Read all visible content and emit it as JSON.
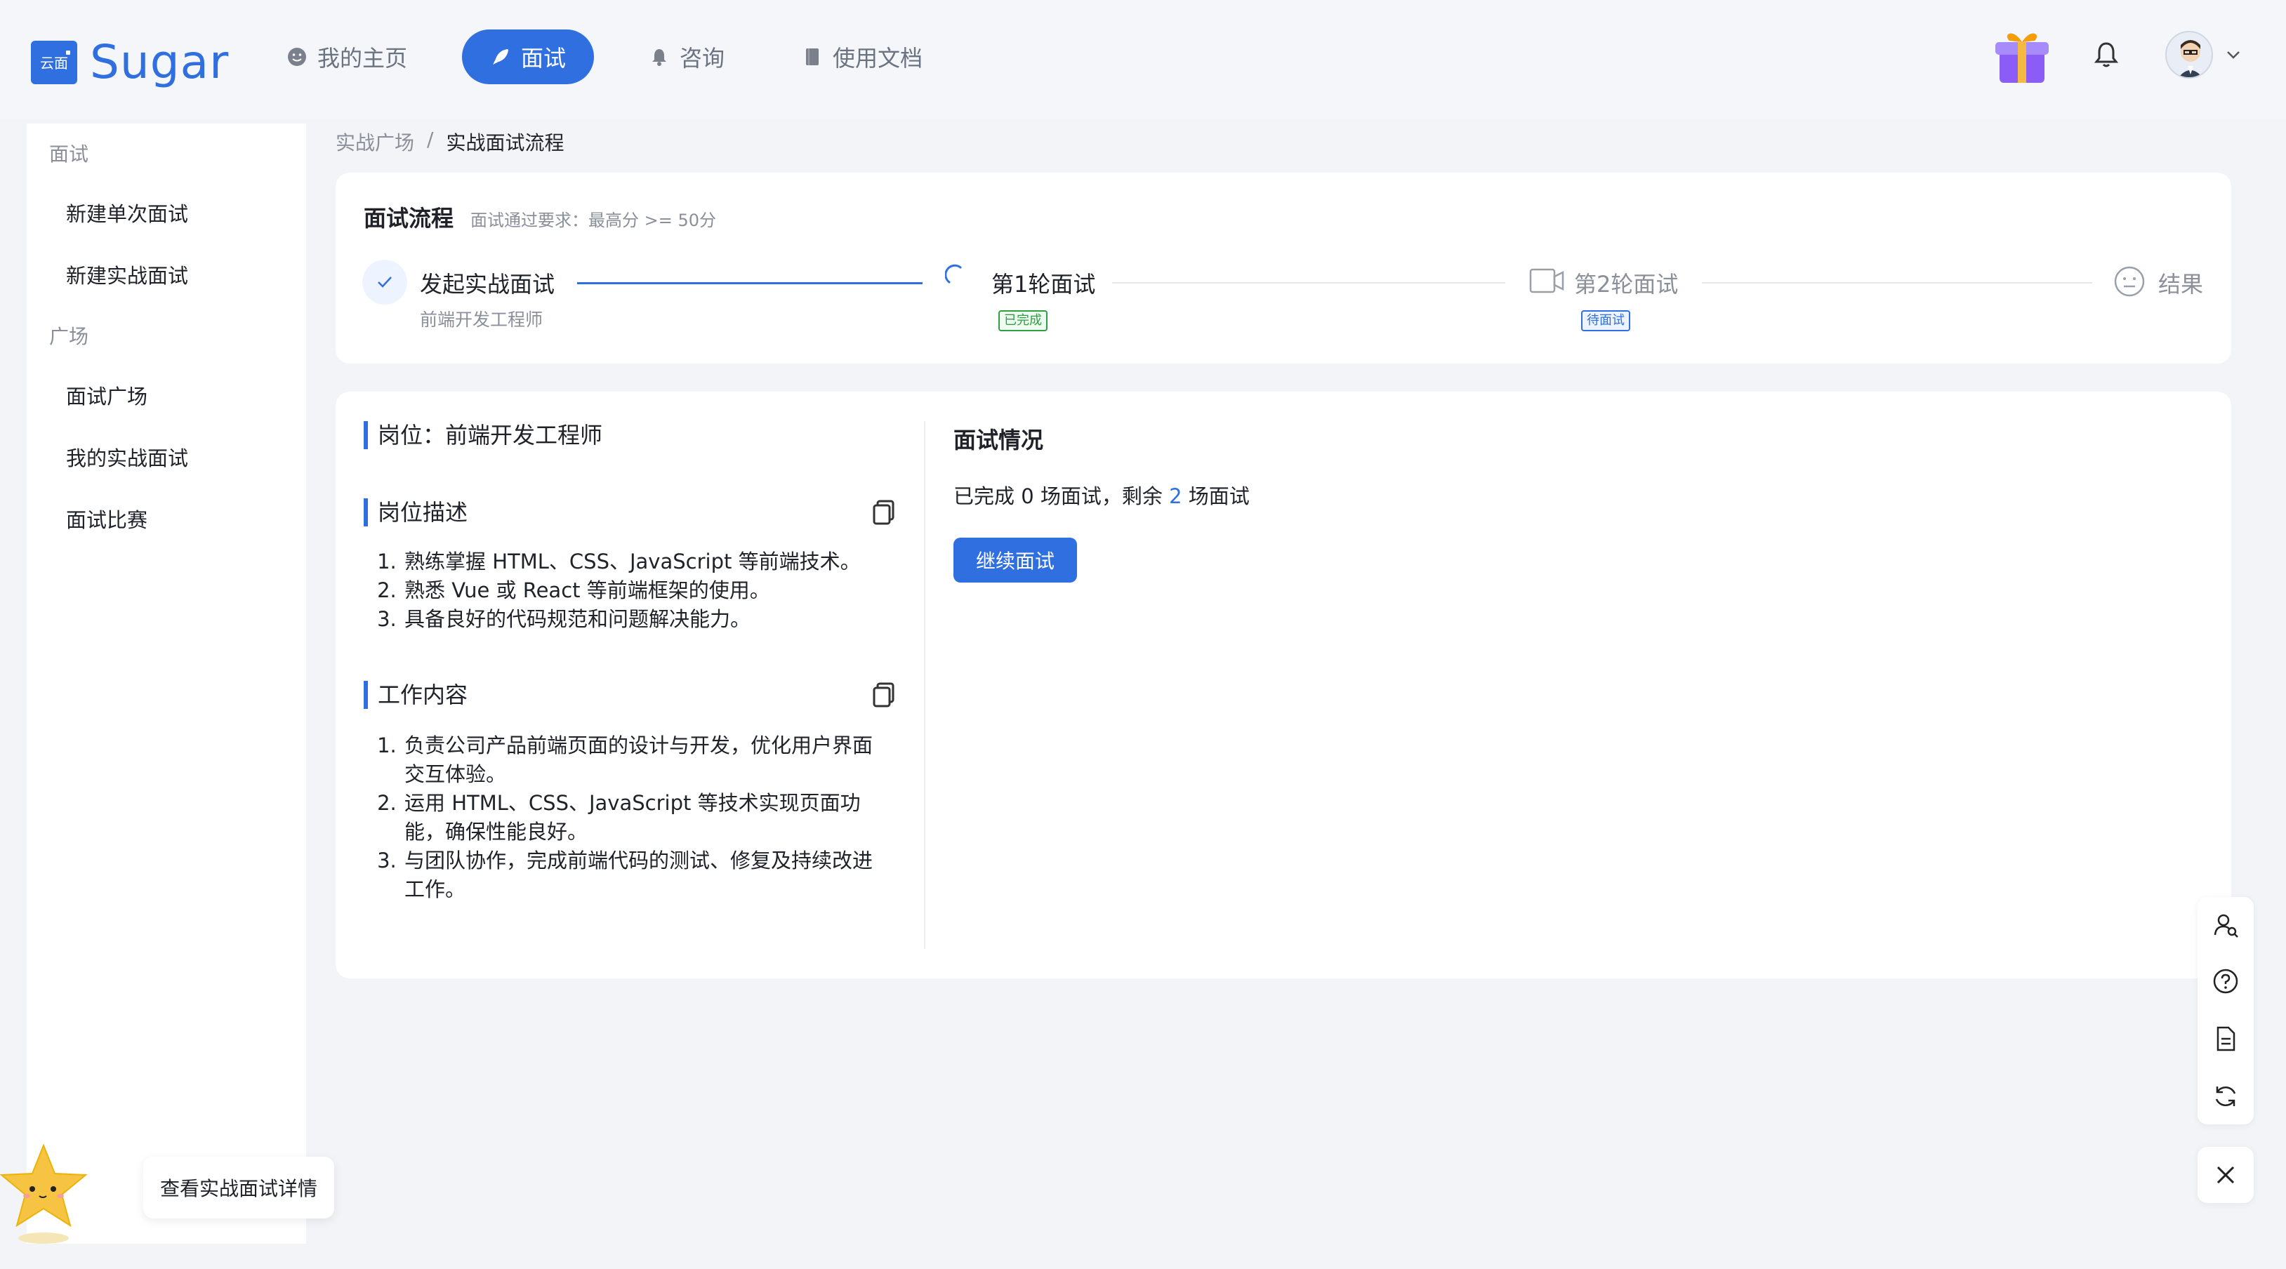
{
  "header": {
    "logo_mark": "云面",
    "logo_text": "Sugar",
    "nav": [
      {
        "label": "我的主页",
        "icon": "face-icon",
        "active": false
      },
      {
        "label": "面试",
        "icon": "rocket-icon",
        "active": true
      },
      {
        "label": "咨询",
        "icon": "bell-small-icon",
        "active": false
      },
      {
        "label": "使用文档",
        "icon": "book-icon",
        "active": false
      }
    ]
  },
  "sidebar": {
    "group_interview": "面试",
    "items_interview": [
      "新建单次面试",
      "新建实战面试"
    ],
    "group_plaza": "广场",
    "items_plaza": [
      "面试广场",
      "我的实战面试",
      "面试比赛"
    ]
  },
  "breadcrumb": {
    "parent": "实战广场",
    "sep": "/",
    "current": "实战面试流程"
  },
  "flow": {
    "title": "面试流程",
    "requirement": "面试通过要求：最高分 >= 50分",
    "steps": [
      {
        "title": "发起实战面试",
        "sub": "前端开发工程师"
      },
      {
        "title": "第1轮面试",
        "tag": "已完成"
      },
      {
        "title": "第2轮面试",
        "tag": "待面试"
      },
      {
        "title": "结果"
      }
    ]
  },
  "job": {
    "position_label": "岗位：前端开发工程师",
    "desc_title": "岗位描述",
    "desc_items": [
      "熟练掌握 HTML、CSS、JavaScript 等前端技术。",
      "熟悉 Vue 或 React 等前端框架的使用。",
      "具备良好的代码规范和问题解决能力。"
    ],
    "work_title": "工作内容",
    "work_items": [
      "负责公司产品前端页面的设计与开发，优化用户界面交互体验。",
      "运用 HTML、CSS、JavaScript 等技术实现页面功能，确保性能良好。",
      "与团队协作，完成前端代码的测试、修复及持续改进工作。"
    ]
  },
  "situation": {
    "title": "面试情况",
    "text_a": "已完成 ",
    "completed": "0",
    "text_b": " 场面试，剩余 ",
    "remaining": "2",
    "text_c": " 场面试",
    "button": "继续面试"
  },
  "tooltip": "查看实战面试详情",
  "colors": {
    "accent": "#2f6fdf",
    "success": "#2ea043"
  }
}
